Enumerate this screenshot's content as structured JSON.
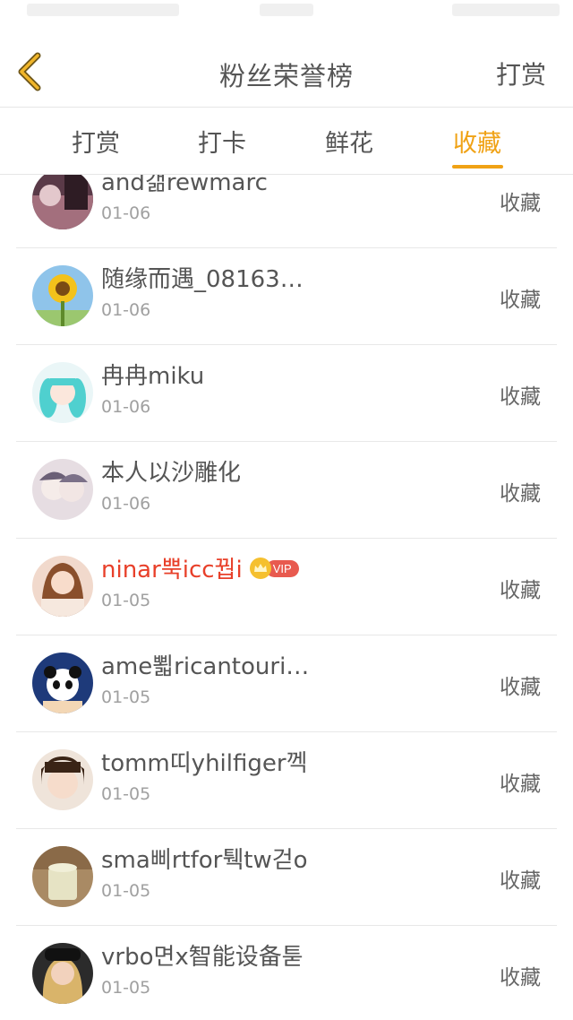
{
  "header": {
    "title": "粉丝荣誉榜",
    "right_action": "打赏",
    "back_icon": "chevron-left-icon",
    "accent_color": "#f0a215"
  },
  "tabs": [
    {
      "label": "打赏",
      "active": false
    },
    {
      "label": "打卡",
      "active": false
    },
    {
      "label": "鲜花",
      "active": false
    },
    {
      "label": "收藏",
      "active": true
    }
  ],
  "fans": [
    {
      "name": "and갦rewmarc",
      "date": "01-06",
      "action": "收藏",
      "vip": false
    },
    {
      "name": "随缘而遇_08163…",
      "date": "01-06",
      "action": "收藏",
      "vip": false
    },
    {
      "name": "冉冉miku",
      "date": "01-06",
      "action": "收藏",
      "vip": false
    },
    {
      "name": "本人以沙雕化",
      "date": "01-06",
      "action": "收藏",
      "vip": false
    },
    {
      "name": "ninar뿍icc꿥i",
      "date": "01-05",
      "action": "收藏",
      "vip": true,
      "vip_label": "VIP"
    },
    {
      "name": "ame뾟ricantouri…",
      "date": "01-05",
      "action": "收藏",
      "vip": false
    },
    {
      "name": "tomm띠yhilfiger껙",
      "date": "01-05",
      "action": "收藏",
      "vip": false
    },
    {
      "name": "sma삐rtfor퉥tw걷o",
      "date": "01-05",
      "action": "收藏",
      "vip": false
    },
    {
      "name": "vrbo면x智能设备툳",
      "date": "01-05",
      "action": "收藏",
      "vip": false
    }
  ]
}
